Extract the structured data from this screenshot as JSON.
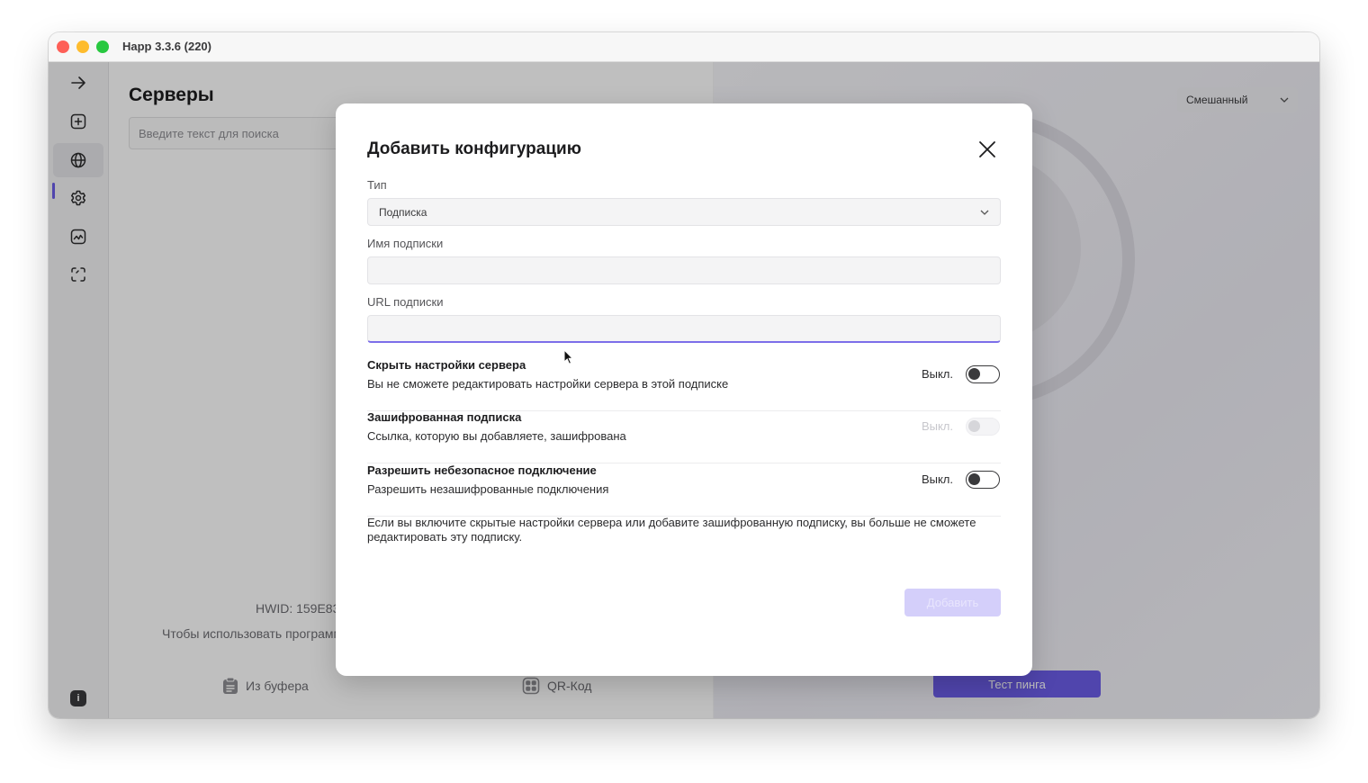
{
  "window": {
    "title": "Happ 3.3.6 (220)"
  },
  "sidebar": {
    "items": [
      {
        "icon": "arrow-right-icon",
        "active": false
      },
      {
        "icon": "add-square-icon",
        "active": false
      },
      {
        "icon": "globe-icon",
        "active": true
      },
      {
        "icon": "gear-icon",
        "active": false
      },
      {
        "icon": "activity-chart-icon",
        "active": false
      },
      {
        "icon": "scan-frame-icon",
        "active": false
      }
    ],
    "info_label": "i"
  },
  "servers": {
    "title": "Серверы",
    "search_placeholder": "Введите текст для поиска",
    "hwid_text": "HWID: 159E83",
    "hint_text": "Чтобы использовать программ",
    "clipboard_button": "Из буфера",
    "qr_button": "QR-Код"
  },
  "right_panel": {
    "mode_value": "Смешанный",
    "ping_button": "Тест пинга"
  },
  "dialog": {
    "title": "Добавить конфигурацию",
    "type_label": "Тип",
    "type_value": "Подписка",
    "name_label": "Имя подписки",
    "name_value": "",
    "url_label": "URL подписки",
    "url_value": "",
    "toggles": [
      {
        "title": "Скрыть настройки сервера",
        "desc": "Вы не сможете редактировать настройки сервера в этой подписке",
        "state": "Выкл.",
        "enabled": true
      },
      {
        "title": "Зашифрованная подписка",
        "desc": "Ссылка, которую вы добавляете, зашифрована",
        "state": "Выкл.",
        "enabled": false
      },
      {
        "title": "Разрешить небезопасное подключение",
        "desc": "Разрешить незашифрованные подключения",
        "state": "Выкл.",
        "enabled": true
      }
    ],
    "note": "Если вы включите скрытые настройки сервера или добавите зашифрованную подписку, вы больше не сможете редактировать эту подписку.",
    "add_button": "Добавить"
  },
  "colors": {
    "accent": "#6b5ce7",
    "accent_disabled": "#d4cffa"
  }
}
